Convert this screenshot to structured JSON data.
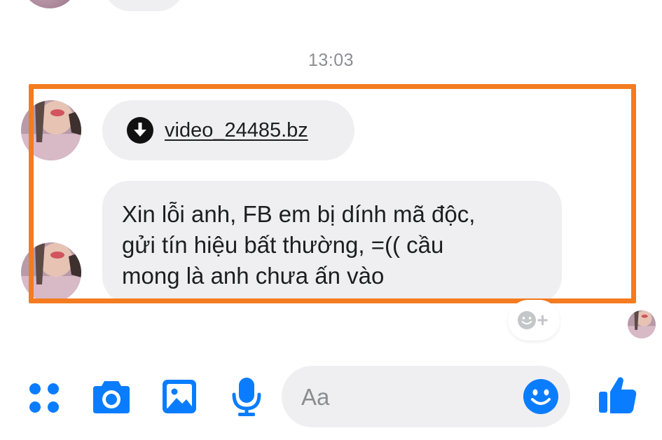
{
  "timestamp": "13:03",
  "messages": {
    "file_name": "video_24485.bz",
    "text_lines": [
      "Xin lỗi anh, FB em bị dính mã độc,",
      "gửi tín hiệu bất thường, =(( cầu",
      "mong là anh chưa ấn vào"
    ]
  },
  "composer": {
    "placeholder": "Aa"
  },
  "icons": {
    "apps": "apps-grid-icon",
    "camera": "camera-icon",
    "gallery": "image-icon",
    "mic": "microphone-icon",
    "emoji": "smiley-icon",
    "like": "thumbs-up-icon",
    "download": "download-icon",
    "react": "add-reaction-icon"
  },
  "colors": {
    "accent": "#0a7cff",
    "highlight": "#f47b20",
    "bubble": "#efeff1"
  }
}
